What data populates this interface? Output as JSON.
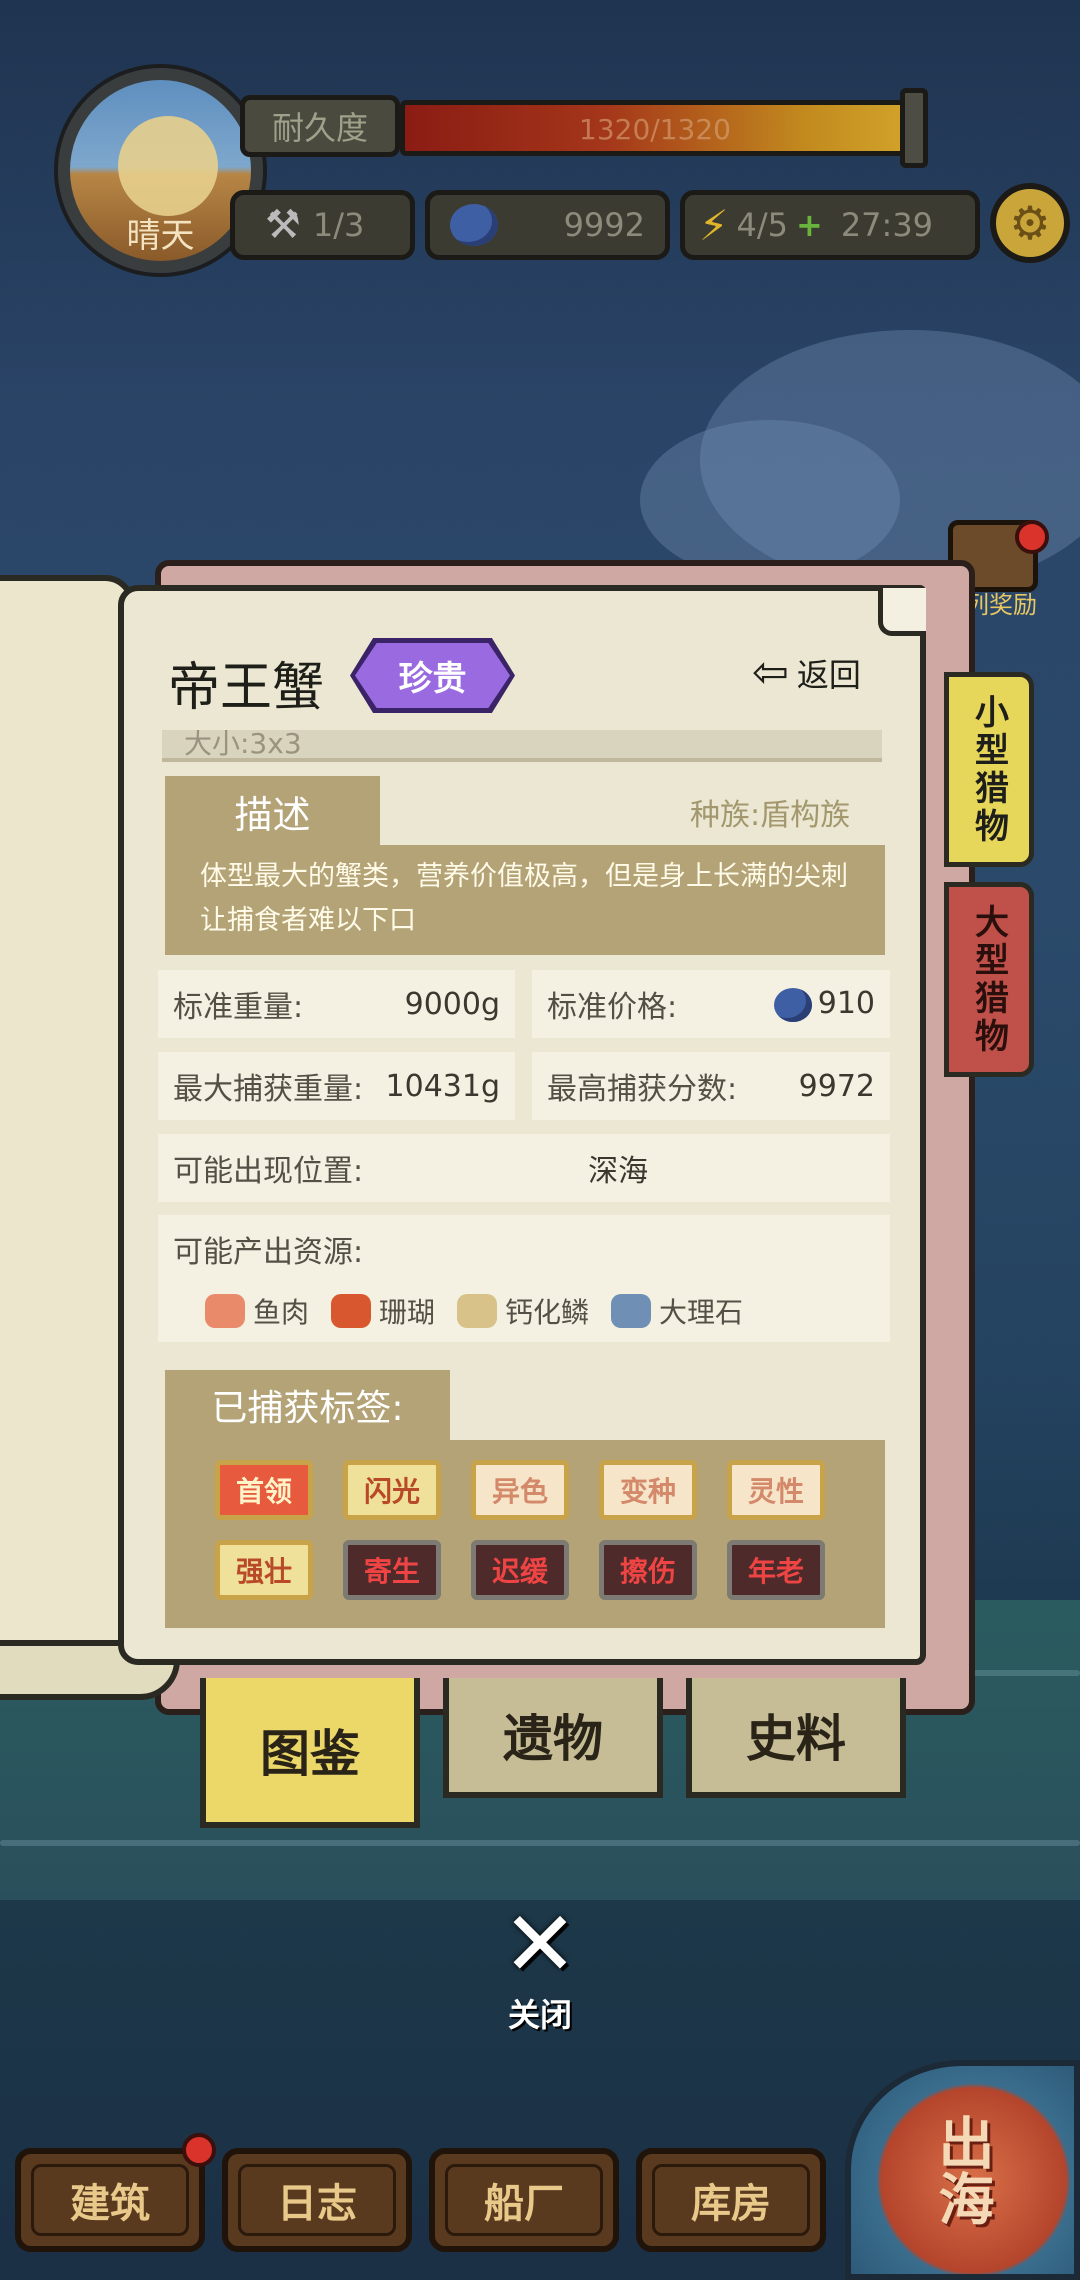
{
  "hud": {
    "weather": "晴天",
    "durability_label": "耐久度",
    "durability_text": "1320/1320",
    "durability_fraction": 1.0,
    "tools": "1/3",
    "currency": "9992",
    "energy": "4/5",
    "energy_plus": "+",
    "timer": "27:39"
  },
  "side": {
    "chest_label": "列奖励",
    "tab_small": "小型猎物",
    "tab_large": "大型猎物"
  },
  "creature": {
    "name": "帝王蟹",
    "rarity": "珍贵",
    "back_label": "返回",
    "size_text": "大小:3x3",
    "desc_tab": "描述",
    "species": "种族:盾构族",
    "description": "体型最大的蟹类，营养价值极高，但是身上长满的尖刺让捕食者难以下口"
  },
  "stats": {
    "std_weight_label": "标准重量:",
    "std_weight_value": "9000g",
    "std_price_label": "标准价格:",
    "std_price_value": "910",
    "max_weight_label": "最大捕获重量:",
    "max_weight_value": "10431g",
    "max_score_label": "最高捕获分数:",
    "max_score_value": "9972",
    "location_label": "可能出现位置:",
    "location_value": "深海",
    "resources_label": "可能产出资源:"
  },
  "resources": [
    {
      "name": "鱼肉",
      "icon": "salmon-icon",
      "color": "#e98a6a"
    },
    {
      "name": "珊瑚",
      "icon": "coral-icon",
      "color": "#d9572e"
    },
    {
      "name": "钙化鳞",
      "icon": "shell-icon",
      "color": "#d8c28a"
    },
    {
      "name": "大理石",
      "icon": "marble-icon",
      "color": "#6f8fb5"
    }
  ],
  "tags_header": "已捕获标签:",
  "tags": [
    {
      "label": "首领",
      "style": "red"
    },
    {
      "label": "闪光",
      "style": "gold"
    },
    {
      "label": "异色",
      "style": "cream"
    },
    {
      "label": "变种",
      "style": "cream"
    },
    {
      "label": "灵性",
      "style": "cream"
    },
    {
      "label": "强壮",
      "style": "gold"
    },
    {
      "label": "寄生",
      "style": "dark"
    },
    {
      "label": "迟缓",
      "style": "dark"
    },
    {
      "label": "擦伤",
      "style": "dark"
    },
    {
      "label": "年老",
      "style": "dark"
    }
  ],
  "book_tabs": [
    "图鉴",
    "遗物",
    "史料"
  ],
  "close_label": "关闭",
  "nav": [
    "建筑",
    "日志",
    "船厂",
    "库房"
  ],
  "sail_label": "出海"
}
